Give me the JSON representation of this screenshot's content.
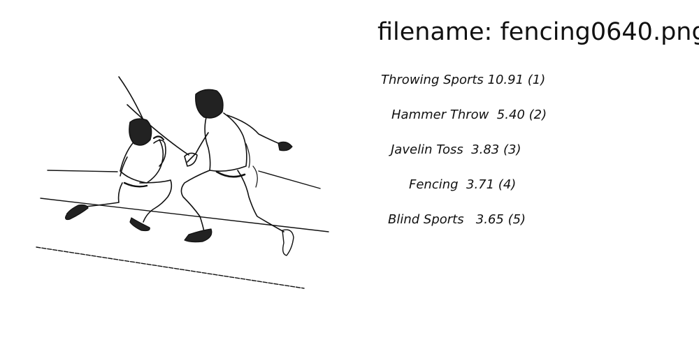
{
  "filename_line": "filename: fencing0640.png",
  "image": {
    "icon": "fencing-illustration"
  },
  "results": [
    {
      "text": "Throwing Sports 10.91 (1)"
    },
    {
      "text": "Hammer Throw  5.40 (2)"
    },
    {
      "text": "Javelin Toss  3.83 (3)"
    },
    {
      "text": "Fencing  3.71 (4)"
    },
    {
      "text": "Blind Sports   3.65 (5)"
    }
  ]
}
